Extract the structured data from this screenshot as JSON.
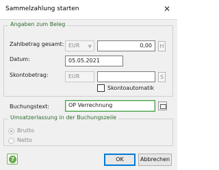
{
  "window": {
    "title": "Sammelzahlung starten"
  },
  "group_beleg": {
    "legend": "Angaben zum Beleg"
  },
  "fields": {
    "zahlbetrag_label": "Zahlbetrag gesamt:",
    "zahlbetrag_currency": "EUR",
    "zahlbetrag_value": "0,00",
    "zahlbetrag_tag": "H",
    "datum_label": "Datum:",
    "datum_value": "05.05.2021",
    "skonto_label": "Skontobetrag:",
    "skonto_currency": "EUR",
    "skonto_value": "",
    "skonto_tag": "S",
    "skontoautomatik_label": "Skontoautomatik",
    "skontoautomatik_checked": false,
    "buchungstext_label": "Buchungstext:",
    "buchungstext_value": "OP Verrechnung"
  },
  "group_ust": {
    "legend": "Umsatzerlassung in der Buchungszeile",
    "options": [
      {
        "label": "Brutto",
        "selected": true
      },
      {
        "label": "Netto",
        "selected": false
      }
    ]
  },
  "buttons": {
    "ok": "OK",
    "cancel": "Abbrechen"
  },
  "icons": {
    "close": "close-icon",
    "help": "help-icon",
    "lookup": "lookup-icon",
    "dropdown": "chevron-down-icon"
  },
  "colors": {
    "accent_green": "#2e6b2e",
    "focus_green": "#4aa04a",
    "default_button_blue": "#0078d7"
  }
}
